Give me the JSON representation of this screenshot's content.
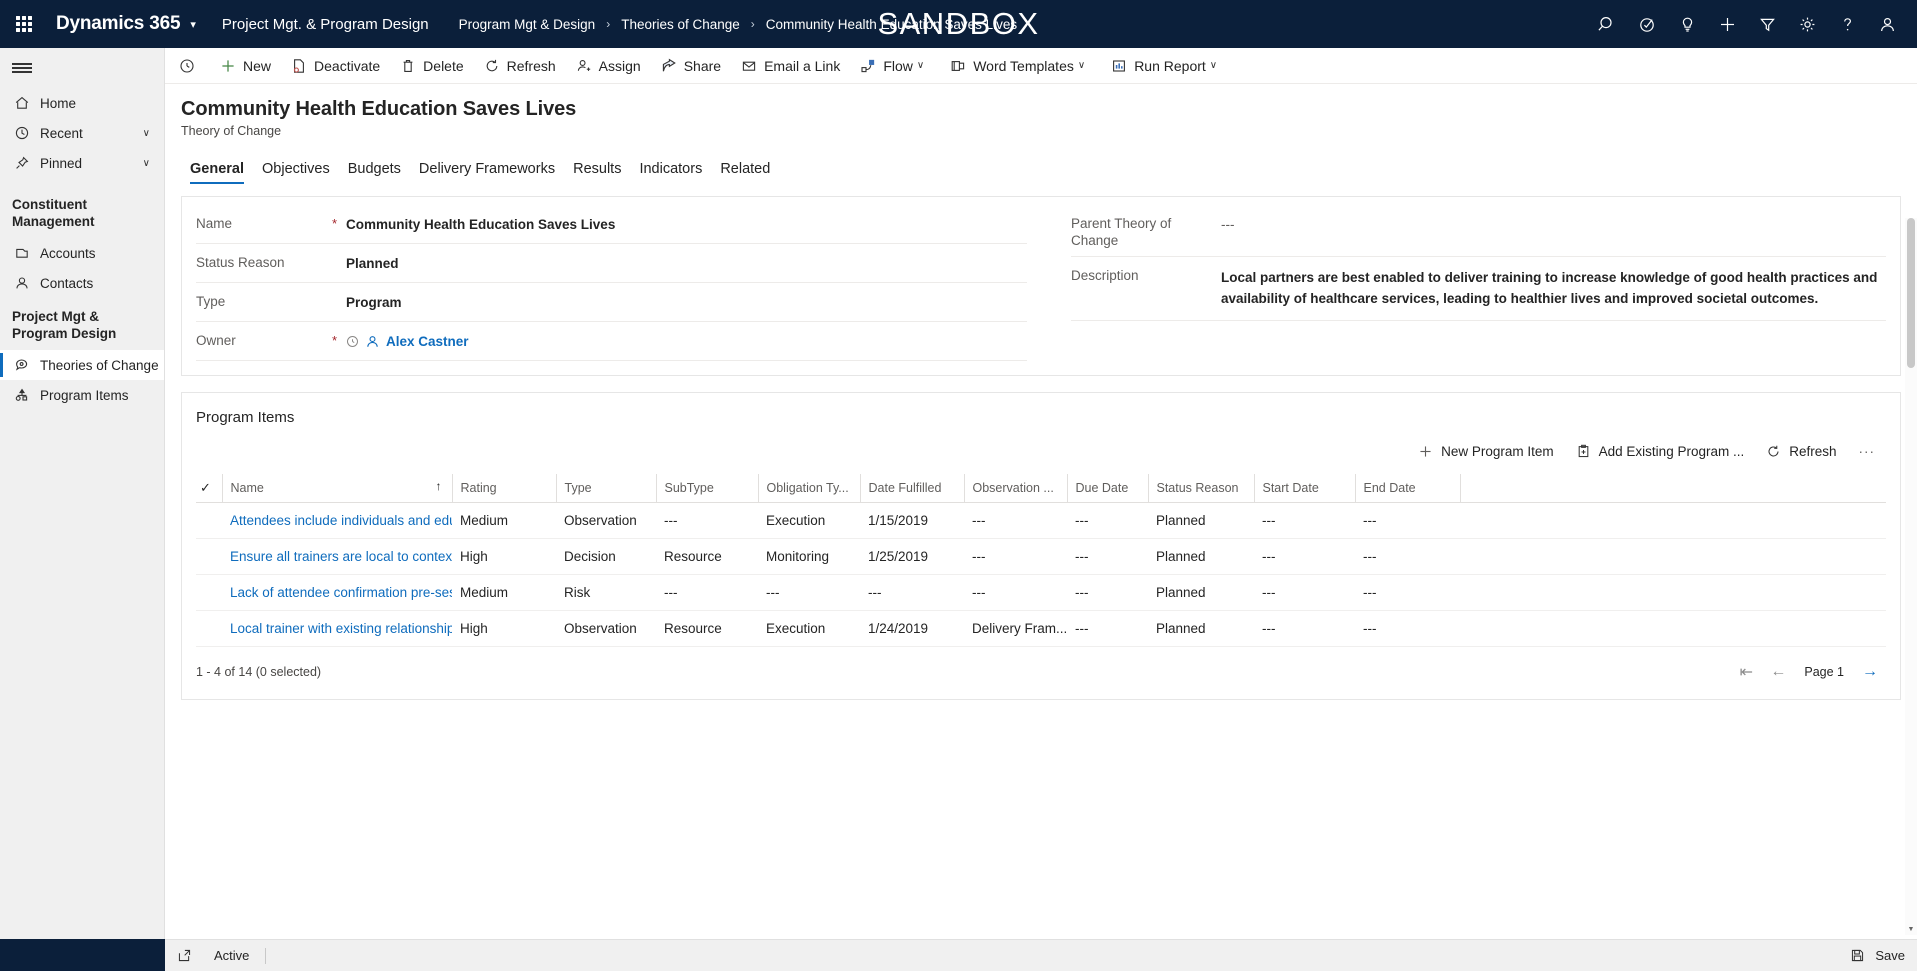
{
  "topbar": {
    "waffle": "app-launcher",
    "brand": "Dynamics 365",
    "app_name": "Project Mgt. & Program Design",
    "breadcrumbs": [
      {
        "label": "Program Mgt & Design"
      },
      {
        "label": "Theories of Change"
      },
      {
        "label": "Community Health Education Saves Lives"
      }
    ],
    "separator": "›",
    "environment_banner": "SANDBOX",
    "icons": [
      {
        "name": "search-icon",
        "title": "Search"
      },
      {
        "name": "quick-assist-icon",
        "title": "Quick assist"
      },
      {
        "name": "lightbulb-icon",
        "title": "Tips"
      },
      {
        "name": "add-icon",
        "title": "Quick create"
      },
      {
        "name": "filter-icon",
        "title": "Filter"
      },
      {
        "name": "gear-icon",
        "title": "Settings"
      },
      {
        "name": "help-icon",
        "title": "Help"
      },
      {
        "name": "account-icon",
        "title": "Account"
      }
    ]
  },
  "sidebar": {
    "hamburger": "site-map-toggle",
    "items": [
      {
        "label": "Home",
        "icon": "home-icon",
        "chevron": "",
        "selected": false
      },
      {
        "label": "Recent",
        "icon": "clock-icon",
        "chevron": "∨",
        "selected": false
      },
      {
        "label": "Pinned",
        "icon": "pin-icon",
        "chevron": "∨",
        "selected": false
      }
    ],
    "group1_title": "Constituent Management",
    "group1_items": [
      {
        "label": "Accounts",
        "icon": "accounts-icon",
        "selected": false
      },
      {
        "label": "Contacts",
        "icon": "contact-icon",
        "selected": false
      }
    ],
    "group2_title": "Project Mgt & Program Design",
    "group2_items": [
      {
        "label": "Theories of Change",
        "icon": "theory-icon",
        "selected": true
      },
      {
        "label": "Program Items",
        "icon": "program-items-icon",
        "selected": false
      }
    ]
  },
  "commandbar": {
    "info_icon": "info-icon",
    "items": [
      {
        "label": "New",
        "icon": "plus-icon",
        "caret": false
      },
      {
        "label": "Deactivate",
        "icon": "deactivate-icon",
        "caret": false
      },
      {
        "label": "Delete",
        "icon": "trash-icon",
        "caret": false
      },
      {
        "label": "Refresh",
        "icon": "refresh-icon",
        "caret": false
      },
      {
        "label": "Assign",
        "icon": "assign-icon",
        "caret": false
      },
      {
        "label": "Share",
        "icon": "share-icon",
        "caret": false
      },
      {
        "label": "Email a Link",
        "icon": "email-link-icon",
        "caret": false
      },
      {
        "label": "Flow",
        "icon": "flow-icon",
        "caret": true
      },
      {
        "label": "Word Templates",
        "icon": "word-template-icon",
        "caret": true
      },
      {
        "label": "Run Report",
        "icon": "run-report-icon",
        "caret": true
      }
    ],
    "caret_glyph": "∨"
  },
  "record": {
    "title": "Community Health Education Saves Lives",
    "subtitle": "Theory of Change"
  },
  "tabs": [
    {
      "label": "General",
      "active": true
    },
    {
      "label": "Objectives",
      "active": false
    },
    {
      "label": "Budgets",
      "active": false
    },
    {
      "label": "Delivery Frameworks",
      "active": false
    },
    {
      "label": "Results",
      "active": false
    },
    {
      "label": "Indicators",
      "active": false
    },
    {
      "label": "Related",
      "active": false
    }
  ],
  "form": {
    "required_marker": "*",
    "left_fields": [
      {
        "label": "Name",
        "required": true,
        "value": "Community Health Education Saves Lives",
        "style": "bold"
      },
      {
        "label": "Status Reason",
        "required": false,
        "value": "Planned",
        "style": "bold"
      },
      {
        "label": "Type",
        "required": false,
        "value": "Program",
        "style": "bold"
      },
      {
        "label": "Owner",
        "required": true,
        "value": "Alex Castner",
        "style": "link"
      }
    ],
    "right_fields": [
      {
        "label": "Parent Theory of Change",
        "required": false,
        "value": "---",
        "style": "dim"
      },
      {
        "label": "Description",
        "required": false,
        "value": "Local partners are best enabled to deliver training to increase knowledge of good health practices and availability of healthcare services, leading to healthier lives and improved societal outcomes.",
        "style": "bold"
      }
    ]
  },
  "subgrid": {
    "title": "Program Items",
    "commands": [
      {
        "label": "New Program Item",
        "icon": "plus-icon"
      },
      {
        "label": "Add Existing Program ...",
        "icon": "add-existing-icon"
      },
      {
        "label": "Refresh",
        "icon": "refresh-icon"
      }
    ],
    "overflow_label": "···",
    "select_all_glyph": "✓",
    "sort_glyph": "↑",
    "columns": [
      "Name",
      "Rating",
      "Type",
      "SubType",
      "Obligation Ty...",
      "Date Fulfilled",
      "Observation ...",
      "Due Date",
      "Status Reason",
      "Start Date",
      "End Date"
    ],
    "rows": [
      {
        "name": "Attendees include individuals and education gr",
        "rating": "Medium",
        "type": "Observation",
        "subtype": "---",
        "obligation_type": "Execution",
        "date_fulfilled": "1/15/2019",
        "observation": "---",
        "due_date": "---",
        "status_reason": "Planned",
        "start_date": "---",
        "end_date": "---"
      },
      {
        "name": "Ensure all trainers are local to context of trainin",
        "rating": "High",
        "type": "Decision",
        "subtype": "Resource",
        "obligation_type": "Monitoring",
        "date_fulfilled": "1/25/2019",
        "observation": "---",
        "due_date": "---",
        "status_reason": "Planned",
        "start_date": "---",
        "end_date": "---"
      },
      {
        "name": "Lack of attendee confirmation pre-sessions dec",
        "rating": "Medium",
        "type": "Risk",
        "subtype": "---",
        "obligation_type": "---",
        "date_fulfilled": "---",
        "observation": "---",
        "due_date": "---",
        "status_reason": "Planned",
        "start_date": "---",
        "end_date": "---"
      },
      {
        "name": "Local trainer with existing relationship improves",
        "rating": "High",
        "type": "Observation",
        "subtype": "Resource",
        "obligation_type": "Execution",
        "date_fulfilled": "1/24/2019",
        "observation": "Delivery Fram...",
        "due_date": "---",
        "status_reason": "Planned",
        "start_date": "---",
        "end_date": "---"
      }
    ],
    "count_label": "1 - 4 of 14 (0 selected)",
    "pager": {
      "first_glyph": "⇤",
      "prev_glyph": "←",
      "page_label": "Page 1",
      "next_glyph": "→"
    }
  },
  "statusbar": {
    "popout_icon": "pop-out-icon",
    "state": "Active",
    "save_label": "Save",
    "save_icon": "save-icon"
  }
}
